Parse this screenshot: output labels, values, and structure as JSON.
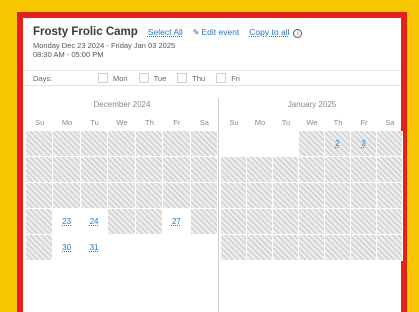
{
  "event": {
    "title": "Frosty Frolic Camp",
    "select_all": "Select All",
    "edit_event": "Edit event",
    "copy_to_all": "Copy to all",
    "date_range": "Monday Dec 23 2024 - Friday Jan 03 2025",
    "time_range": "08:30 AM - 05:00 PM"
  },
  "days_filter": {
    "label": "Days:",
    "options": [
      "Mon",
      "Tue",
      "Thu",
      "Fri"
    ]
  },
  "weekday_headers": [
    "Su",
    "Mo",
    "Tu",
    "We",
    "Th",
    "Fr",
    "Sa"
  ],
  "months": [
    {
      "name": "December 2024",
      "cells": [
        {
          "t": "h"
        },
        {
          "t": "h"
        },
        {
          "t": "h"
        },
        {
          "t": "h"
        },
        {
          "t": "h"
        },
        {
          "t": "h"
        },
        {
          "t": "h"
        },
        {
          "t": "h"
        },
        {
          "t": "h"
        },
        {
          "t": "h"
        },
        {
          "t": "h"
        },
        {
          "t": "h"
        },
        {
          "t": "h"
        },
        {
          "t": "h"
        },
        {
          "t": "h"
        },
        {
          "t": "h"
        },
        {
          "t": "h"
        },
        {
          "t": "h"
        },
        {
          "t": "h"
        },
        {
          "t": "h"
        },
        {
          "t": "h"
        },
        {
          "t": "h"
        },
        {
          "t": "a",
          "d": "23"
        },
        {
          "t": "a",
          "d": "24"
        },
        {
          "t": "h"
        },
        {
          "t": "h"
        },
        {
          "t": "a",
          "d": "27"
        },
        {
          "t": "h"
        },
        {
          "t": "h"
        },
        {
          "t": "a",
          "d": "30"
        },
        {
          "t": "a",
          "d": "31"
        },
        {
          "t": "b"
        },
        {
          "t": "b"
        },
        {
          "t": "b"
        },
        {
          "t": "b"
        }
      ]
    },
    {
      "name": "January 2025",
      "cells": [
        {
          "t": "b"
        },
        {
          "t": "b"
        },
        {
          "t": "b"
        },
        {
          "t": "h"
        },
        {
          "t": "ah",
          "d": "2"
        },
        {
          "t": "ah",
          "d": "3"
        },
        {
          "t": "h"
        },
        {
          "t": "h"
        },
        {
          "t": "h"
        },
        {
          "t": "h"
        },
        {
          "t": "h"
        },
        {
          "t": "h"
        },
        {
          "t": "h"
        },
        {
          "t": "h"
        },
        {
          "t": "h"
        },
        {
          "t": "h"
        },
        {
          "t": "h"
        },
        {
          "t": "h"
        },
        {
          "t": "h"
        },
        {
          "t": "h"
        },
        {
          "t": "h"
        },
        {
          "t": "h"
        },
        {
          "t": "h"
        },
        {
          "t": "h"
        },
        {
          "t": "h"
        },
        {
          "t": "h"
        },
        {
          "t": "h"
        },
        {
          "t": "h"
        },
        {
          "t": "h"
        },
        {
          "t": "h"
        },
        {
          "t": "h"
        },
        {
          "t": "h"
        },
        {
          "t": "h"
        },
        {
          "t": "h"
        },
        {
          "t": "h"
        }
      ]
    }
  ],
  "colors": {
    "accent": "#2a78c2",
    "frame": "#e3211b",
    "page_bg": "#f7c600"
  }
}
